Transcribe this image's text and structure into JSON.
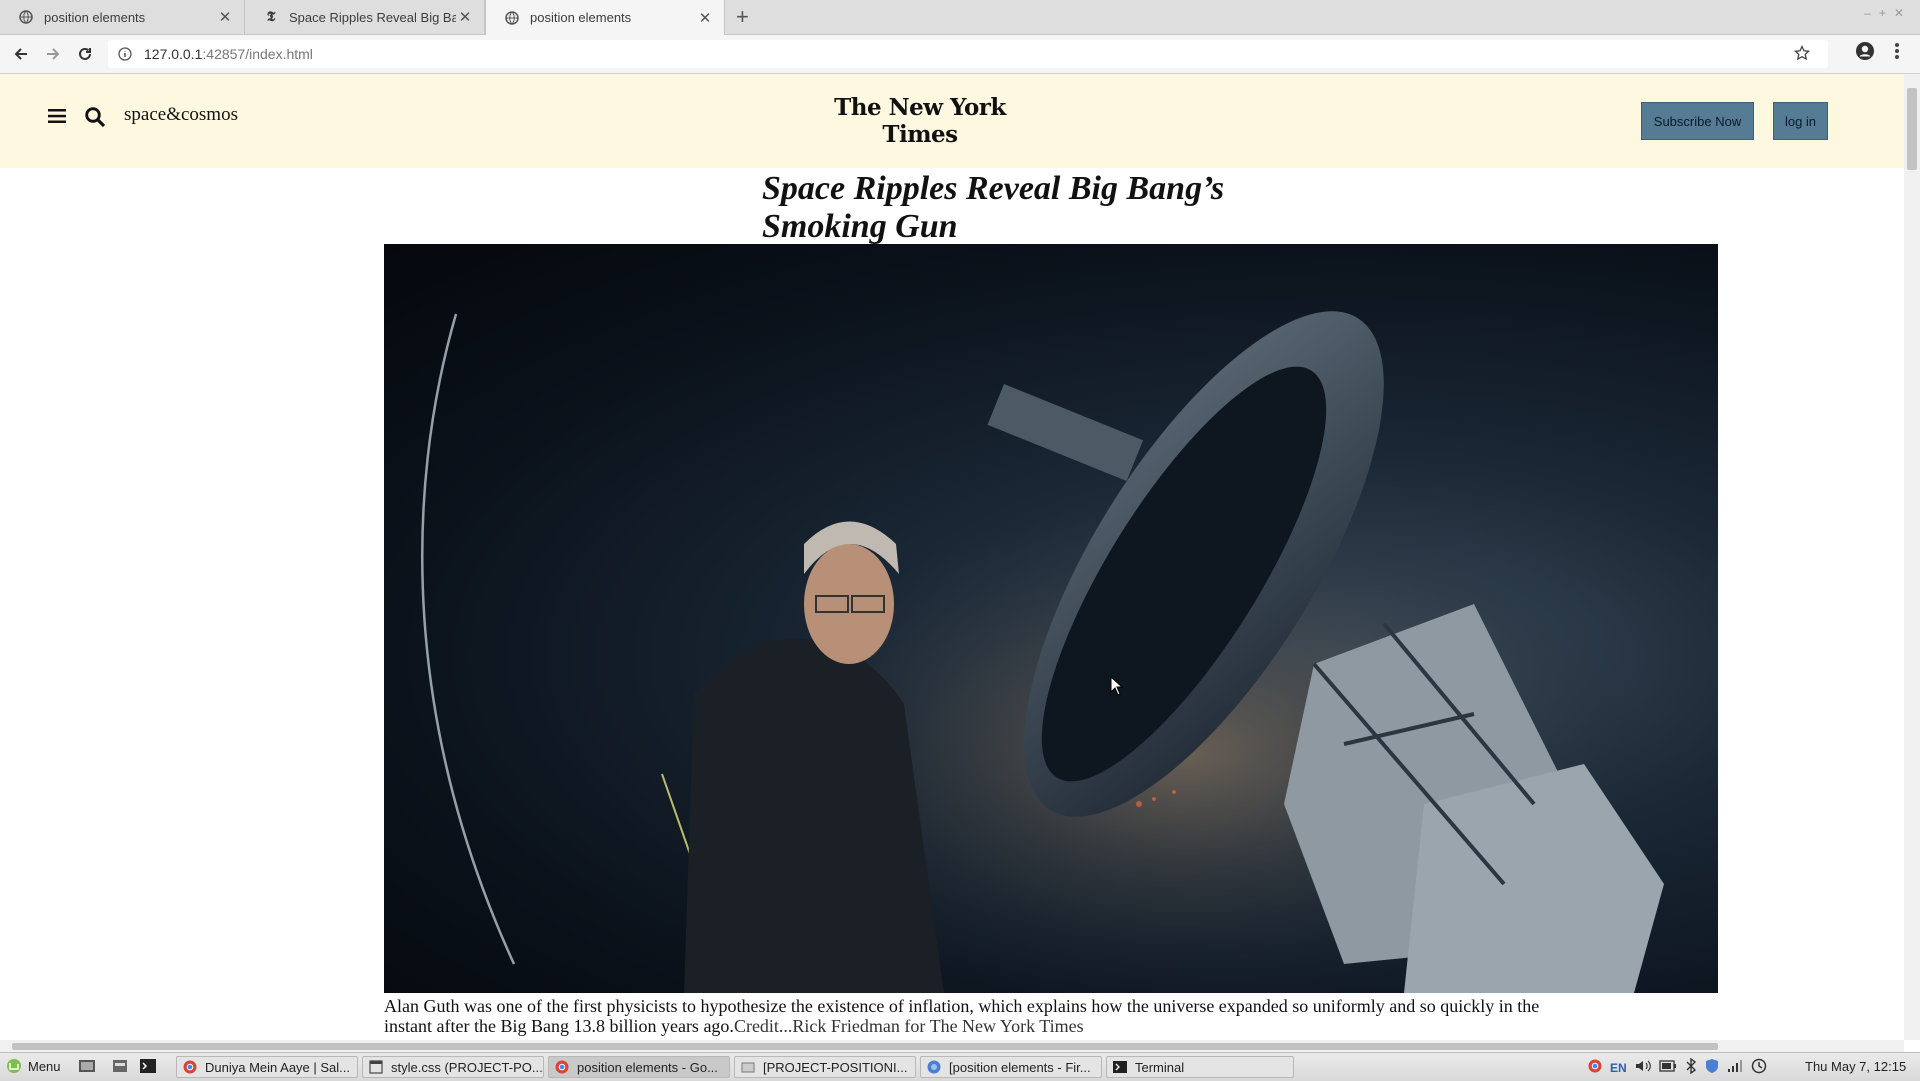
{
  "browser": {
    "tabs": [
      {
        "title": "position elements",
        "icon": "globe-icon",
        "active": false
      },
      {
        "title": "Space Ripples Reveal Big Bang's Smoking Gun",
        "icon": "nyt-favicon",
        "active": false
      },
      {
        "title": "position elements",
        "icon": "globe-icon",
        "active": true
      }
    ],
    "url_host": "127.0.0.1",
    "url_rest": ":42857/index.html"
  },
  "page": {
    "section": "space&cosmos",
    "logo": "The New York Times",
    "subscribe_label": "Subscribe Now",
    "login_label": "log in",
    "headline": "Space Ripples Reveal Big Bang’s Smoking Gun",
    "caption": "Alan Guth was one of the first physicists to hypothesize the existence of inflation, which explains how the universe expanded so uniformly and so quickly in the instant after the Big Bang 13.8 billion years ago.",
    "credit": "Credit...Rick Friedman for The New York Times",
    "colors": {
      "header_bg": "#fff8e1",
      "button_bg": "#567b95"
    }
  },
  "taskbar": {
    "menu_label": "Menu",
    "items": [
      {
        "label": "Duniya Mein Aaye | Sal...",
        "icon": "chrome-icon",
        "active": false
      },
      {
        "label": "style.css (PROJECT-PO...",
        "icon": "editor-icon",
        "active": false
      },
      {
        "label": "position elements - Go...",
        "icon": "chrome-icon",
        "active": true
      },
      {
        "label": "[PROJECT-POSITIONI...",
        "icon": "folder-icon",
        "active": false
      },
      {
        "label": "[position elements - Fir...",
        "icon": "firefox-icon",
        "active": false
      },
      {
        "label": "Terminal",
        "icon": "terminal-icon",
        "active": false
      }
    ],
    "tray_lang": "EN",
    "clock": "Thu May 7, 12:15"
  }
}
